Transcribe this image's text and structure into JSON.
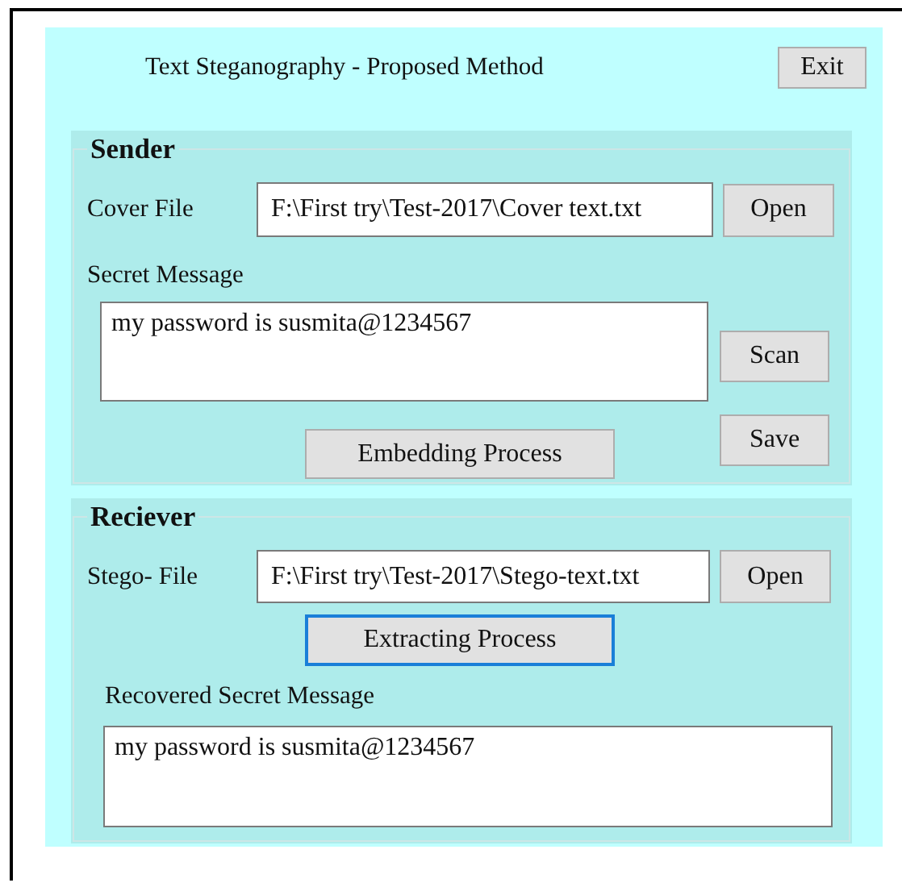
{
  "window": {
    "title": "Text Steganography - Proposed Method",
    "exit_button": "Exit"
  },
  "sender": {
    "legend": "Sender",
    "cover_file": {
      "label": "Cover File",
      "value": "F:\\First try\\Test-2017\\Cover text.txt",
      "button": "Open"
    },
    "secret_message": {
      "label": "Secret Message",
      "value": "my password is susmita@1234567",
      "scan_button": "Scan",
      "save_button": "Save"
    },
    "embed_button": {
      "label": "Embedding Process",
      "focused": false
    }
  },
  "receiver": {
    "legend": "Reciever",
    "stego_file": {
      "label": "Stego- File",
      "value": "F:\\First try\\Test-2017\\Stego-text.txt",
      "button": "Open"
    },
    "extract_button": {
      "label": "Extracting Process",
      "focused": true
    },
    "recovered": {
      "label": "Recovered Secret Message",
      "value": "my password is susmita@1234567"
    }
  }
}
